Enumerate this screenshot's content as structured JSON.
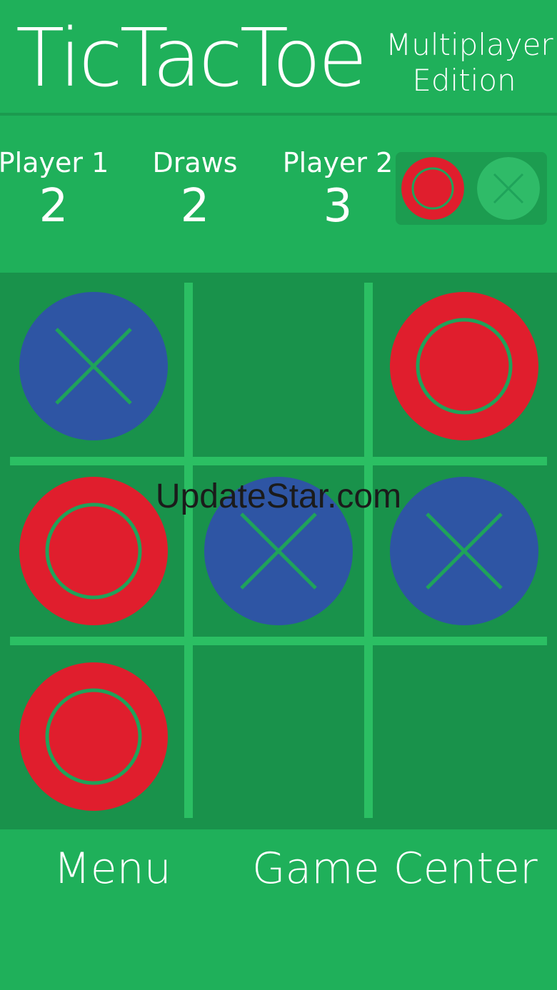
{
  "header": {
    "title": "TicTacToe",
    "subtitle_line1": "Multiplayer",
    "subtitle_line2": "Edition"
  },
  "scores": {
    "player1_label": "Player 1",
    "player1_value": "2",
    "draws_label": "Draws",
    "draws_value": "2",
    "player2_label": "Player 2",
    "player2_value": "3"
  },
  "turn_indicator": {
    "active": "O",
    "icons": [
      "o-piece-icon",
      "x-piece-icon"
    ]
  },
  "board": {
    "cells": [
      "X",
      "",
      "O",
      "O",
      "X",
      "X",
      "O",
      "",
      ""
    ]
  },
  "watermark": "UpdateStar.com",
  "footer": {
    "menu_label": "Menu",
    "game_center_label": "Game Center"
  },
  "colors": {
    "background": "#1fb05a",
    "board": "#19924b",
    "grid": "#2bbf63",
    "o_piece": "#e01e2d",
    "x_piece": "#2e55a4",
    "mark_stroke": "#1fa35a"
  }
}
